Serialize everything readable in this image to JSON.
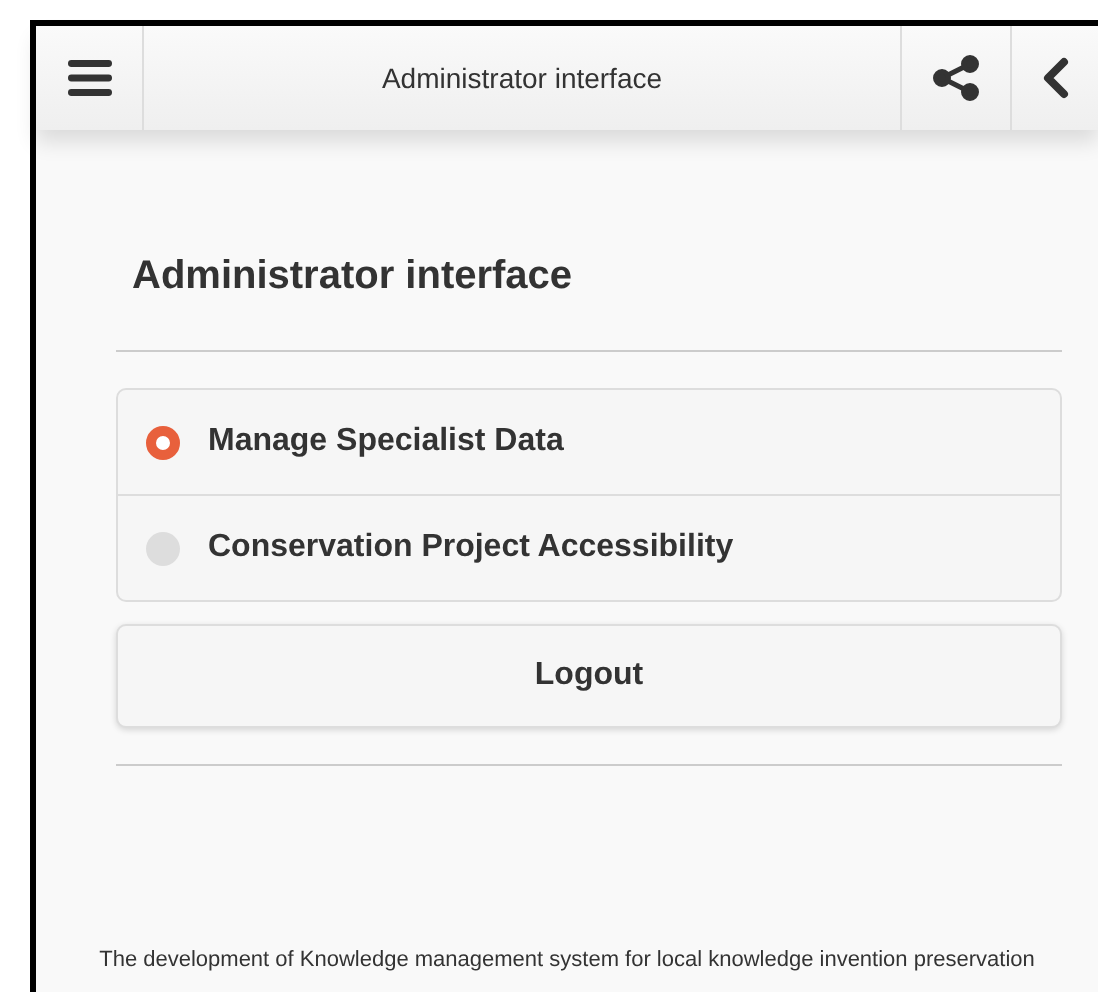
{
  "header": {
    "title": "Administrator interface"
  },
  "heading": "Administrator interface",
  "options": [
    {
      "label": "Manage Specialist Data",
      "selected": true
    },
    {
      "label": "Conservation Project Accessibility",
      "selected": false
    }
  ],
  "logout": "Logout",
  "footer": "The development of Knowledge management system for local knowledge invention preservation"
}
